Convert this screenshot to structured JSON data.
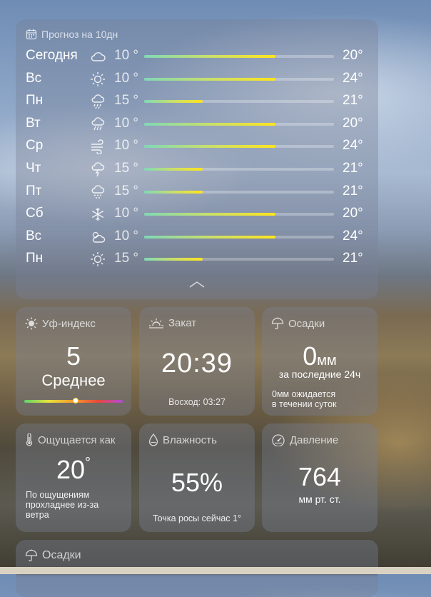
{
  "forecast": {
    "title": "Прогноз на 10дн",
    "rows": [
      {
        "day": "Сегодня",
        "icon": "cloud-icon",
        "low": "10 °",
        "high": "20°",
        "range": [
          0.0,
          0.69
        ]
      },
      {
        "day": "Вс",
        "icon": "sun-icon",
        "low": "10 °",
        "high": "24°",
        "range": [
          0.0,
          0.69
        ]
      },
      {
        "day": "Пн",
        "icon": "rain-heavy-icon",
        "low": "15 °",
        "high": "21°",
        "range": [
          0.0,
          0.31
        ]
      },
      {
        "day": "Вт",
        "icon": "rain-icon",
        "low": "10 °",
        "high": "20°",
        "range": [
          0.0,
          0.69
        ]
      },
      {
        "day": "Ср",
        "icon": "wind-icon",
        "low": "10 °",
        "high": "24°",
        "range": [
          0.0,
          0.69
        ]
      },
      {
        "day": "Чт",
        "icon": "thunder-icon",
        "low": "15 °",
        "high": "21°",
        "range": [
          0.0,
          0.31
        ]
      },
      {
        "day": "Пт",
        "icon": "drizzle-icon",
        "low": "15 °",
        "high": "21°",
        "range": [
          0.0,
          0.31
        ]
      },
      {
        "day": "Сб",
        "icon": "snow-icon",
        "low": "10 °",
        "high": "20°",
        "range": [
          0.0,
          0.69
        ]
      },
      {
        "day": "Вс",
        "icon": "partly-cloudy-icon",
        "low": "10 °",
        "high": "24°",
        "range": [
          0.0,
          0.69
        ]
      },
      {
        "day": "Пн",
        "icon": "sun-icon",
        "low": "15 °",
        "high": "21°",
        "range": [
          0.0,
          0.31
        ]
      }
    ]
  },
  "uv": {
    "title": "Уф-индекс",
    "value": "5",
    "level": "Среднее",
    "position": 0.52
  },
  "sunset": {
    "title": "Закат",
    "time": "20:39",
    "sunrise": "Восход: 03:27"
  },
  "precip": {
    "title": "Осадки",
    "value": "0",
    "unit": "мм",
    "period": "за последние 24ч",
    "note1": "0мм ожидается",
    "note2": "в течении суток"
  },
  "feels": {
    "title": "Ощущается как",
    "value": "20",
    "degree": "°",
    "note1": "По ощущениям",
    "note2": "прохладнее из-за",
    "note3": "ветра"
  },
  "humidity": {
    "title": "Влажность",
    "value": "55%",
    "dew": "Точка росы сейчас 1°"
  },
  "pressure": {
    "title": "Давление",
    "value": "764",
    "unit": "мм рт. ст."
  },
  "bottom": {
    "title": "Осадки"
  },
  "colors": {
    "bar_start": "#7fd9b6",
    "bar_end": "#ffe51c",
    "card": "#78829660"
  }
}
